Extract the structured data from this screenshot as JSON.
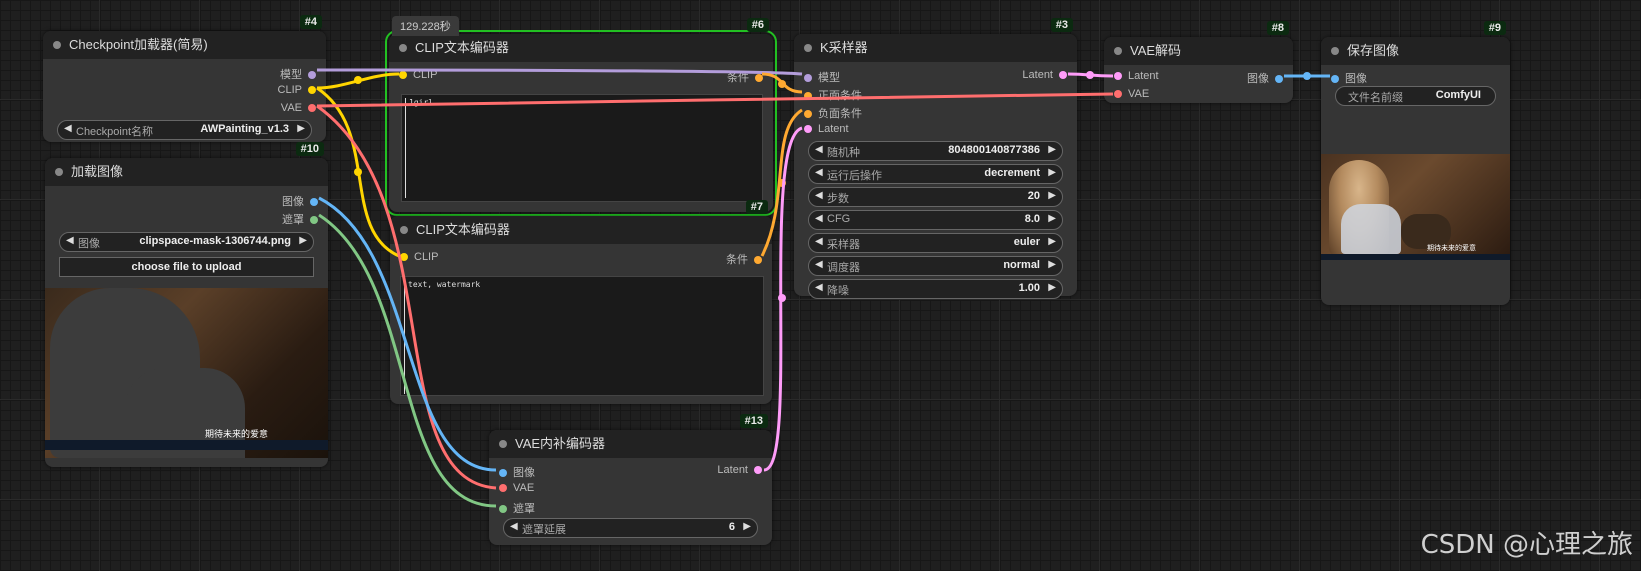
{
  "colors": {
    "model": "#b39ddb",
    "clip": "#ffd500",
    "vae": "#ff6e6e",
    "conditioning": "#ffa931",
    "latent": "#ff9cf9",
    "image": "#64b5f6",
    "mask": "#81c784",
    "running": "#22c022",
    "badge_bg": "#0b2a10"
  },
  "nodes": {
    "checkpoint": {
      "id": "#4",
      "title": "Checkpoint加载器(简易)",
      "outputs": [
        "模型",
        "CLIP",
        "VAE"
      ],
      "widget": {
        "label": "Checkpoint名称",
        "value": "AWPainting_v1.3"
      }
    },
    "load_image": {
      "id": "#10",
      "title": "加载图像",
      "outputs": [
        "图像",
        "遮罩"
      ],
      "widget": {
        "label": "图像",
        "value": "clipspace-mask-1306744.png"
      },
      "upload_label": "choose file to upload",
      "preview_caption": "期待未来的爱意"
    },
    "clip_pos": {
      "id": "#6",
      "title": "CLIP文本编码器",
      "exec_time": "129.228秒",
      "input": "CLIP",
      "output": "条件",
      "text": "1girl"
    },
    "clip_neg": {
      "id": "#7",
      "title": "CLIP文本编码器",
      "input": "CLIP",
      "output": "条件",
      "text": "text, watermark"
    },
    "ksampler": {
      "id": "#3",
      "title": "K采样器",
      "inputs": [
        "模型",
        "正面条件",
        "负面条件",
        "Latent"
      ],
      "output": "Latent",
      "widgets": [
        {
          "label": "随机种",
          "value": "804800140877386"
        },
        {
          "label": "运行后操作",
          "value": "decrement"
        },
        {
          "label": "步数",
          "value": "20"
        },
        {
          "label": "CFG",
          "value": "8.0"
        },
        {
          "label": "采样器",
          "value": "euler"
        },
        {
          "label": "调度器",
          "value": "normal"
        },
        {
          "label": "降噪",
          "value": "1.00"
        }
      ]
    },
    "vae_decode": {
      "id": "#8",
      "title": "VAE解码",
      "inputs": [
        "Latent",
        "VAE"
      ],
      "output": "图像"
    },
    "save_image": {
      "id": "#9",
      "title": "保存图像",
      "input": "图像",
      "widget": {
        "label": "文件名前缀",
        "value": "ComfyUI"
      },
      "preview_caption": "期待未来的爱意"
    },
    "vae_inpaint": {
      "id": "#13",
      "title": "VAE内补编码器",
      "inputs": [
        "图像",
        "VAE",
        "遮罩"
      ],
      "output": "Latent",
      "widget": {
        "label": "遮罩延展",
        "value": "6"
      }
    }
  },
  "watermark": "CSDN @心理之旅"
}
